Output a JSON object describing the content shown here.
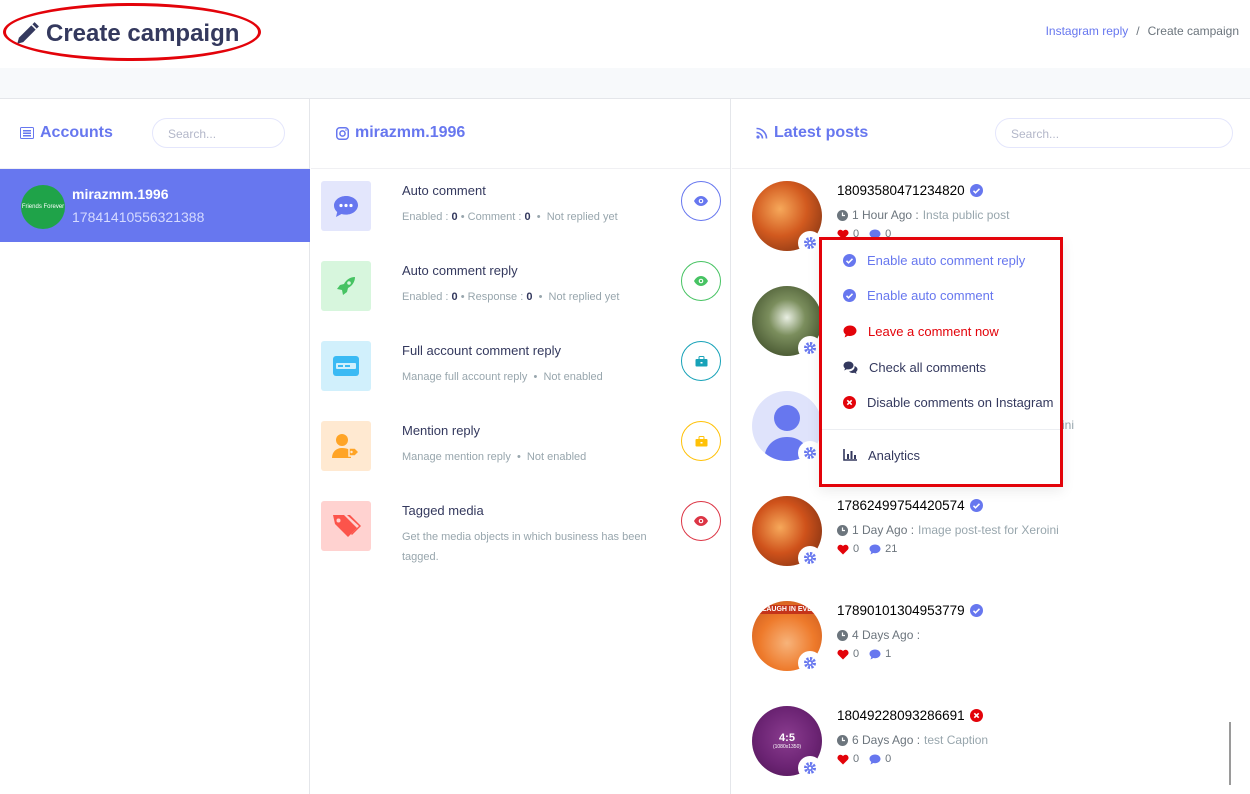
{
  "header": {
    "title": "Create campaign",
    "breadcrumb": {
      "parent": "Instagram reply",
      "separator": "/",
      "current": "Create campaign"
    }
  },
  "accounts": {
    "heading": "Accounts",
    "search_placeholder": "Search...",
    "items": [
      {
        "name": "mirazmm.1996",
        "id": "17841410556321388",
        "avatar_text": "Friends Forever",
        "active": true
      }
    ]
  },
  "account_panel": {
    "heading": "mirazmm.1996",
    "features": [
      {
        "title": "Auto comment",
        "parts": [
          {
            "label": "Enabled : ",
            "value": "0"
          },
          {
            "label": "Comment : ",
            "value": "0"
          }
        ],
        "status": "Not replied yet",
        "icon": "comment-dots-icon",
        "action_icon": "eye-icon",
        "color": "#6777ef",
        "bg": "#e3e6fc"
      },
      {
        "title": "Auto comment reply",
        "parts": [
          {
            "label": "Enabled : ",
            "value": "0"
          },
          {
            "label": "Response : ",
            "value": "0"
          }
        ],
        "status": "Not replied yet",
        "icon": "rocket-icon",
        "action_icon": "eye-icon",
        "color": "#47c363",
        "bg": "#d7f6dd"
      },
      {
        "title": "Full account comment reply",
        "desc": "Manage full account reply",
        "status": "Not enabled",
        "icon": "credit-card-icon",
        "action_icon": "briefcase-icon",
        "color": "#3abaf4",
        "bg": "#d1f0fc"
      },
      {
        "title": "Mention reply",
        "desc": "Manage mention reply",
        "status": "Not enabled",
        "icon": "user-tag-icon",
        "action_icon": "briefcase-icon",
        "color": "#ffa426",
        "bg": "#ffe9d1"
      },
      {
        "title": "Tagged media",
        "desc": "Get the media objects in which business has been tagged.",
        "icon": "tags-icon",
        "action_icon": "eye-icon",
        "color": "#fc544b",
        "bg": "#ffd2d0"
      }
    ]
  },
  "posts": {
    "heading": "Latest posts",
    "search_placeholder": "Search...",
    "items": [
      {
        "id": "18093580471234820",
        "verified": true,
        "ago": "1 Hour Ago :",
        "caption": "Insta public post",
        "likes": "0",
        "comments": "0",
        "thumb": "autumn"
      },
      {
        "id": "",
        "verified": null,
        "ago": "",
        "caption": "",
        "likes": "",
        "comments": "",
        "thumb": "forest"
      },
      {
        "id": "",
        "verified": null,
        "ago": "",
        "caption": "ini",
        "likes": "",
        "comments": "",
        "thumb": "avatar"
      },
      {
        "id": "17862499754420574",
        "verified": true,
        "ago": "1 Day Ago :",
        "caption": "Image post-test for Xeroini",
        "likes": "0",
        "comments": "21",
        "thumb": "autumn"
      },
      {
        "id": "17890101304953779",
        "verified": true,
        "ago": "4 Days Ago :",
        "caption": "",
        "likes": "0",
        "comments": "1",
        "thumb": "orange",
        "thumb_text": "LAUGH IN EVE"
      },
      {
        "id": "18049228093286691",
        "verified": false,
        "ago": "6 Days Ago :",
        "caption": "test Caption",
        "likes": "0",
        "comments": "0",
        "thumb": "purple",
        "thumb_text": "4:5",
        "thumb_sub": "(1080x1350)"
      }
    ]
  },
  "menu": {
    "items": [
      {
        "label": "Enable auto comment reply",
        "icon": "check-circle-icon",
        "color": "#6777ef"
      },
      {
        "label": "Enable auto comment",
        "icon": "check-circle-icon",
        "color": "#6777ef"
      },
      {
        "label": "Leave a comment now",
        "icon": "comment-icon",
        "color": "#e3030a"
      },
      {
        "label": "Check all comments",
        "icon": "comments-icon",
        "color": "#34395e"
      },
      {
        "label": "Disable comments on Instagram",
        "icon": "times-circle-icon",
        "color": "#e3030a"
      },
      {
        "label": "Analytics",
        "icon": "chart-bar-icon",
        "color": "#34395e"
      }
    ]
  }
}
